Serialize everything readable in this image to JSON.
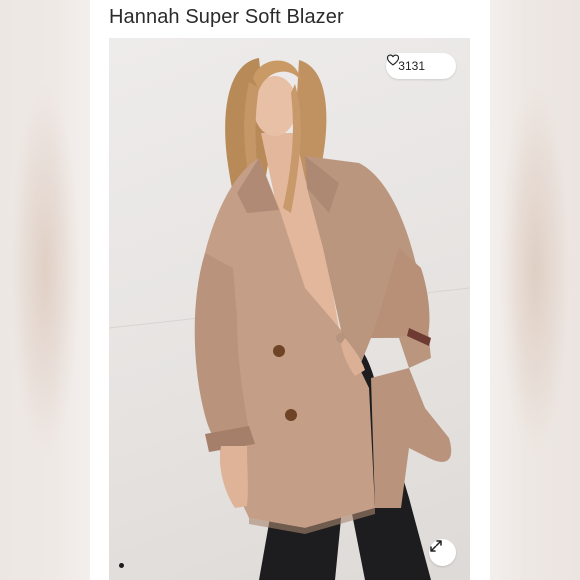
{
  "product": {
    "title": "Hannah Super Soft Blazer"
  },
  "gallery": {
    "like_count": "3131",
    "like_icon": "heart-outline-icon",
    "expand_icon": "expand-icon",
    "image_alt": "Model wearing a tan double-breasted blazer with black jeans",
    "slide_indicator": "dot"
  },
  "colors": {
    "coat": "#c49e86",
    "background": "#e9e6e3",
    "jeans": "#1d1d1f"
  }
}
